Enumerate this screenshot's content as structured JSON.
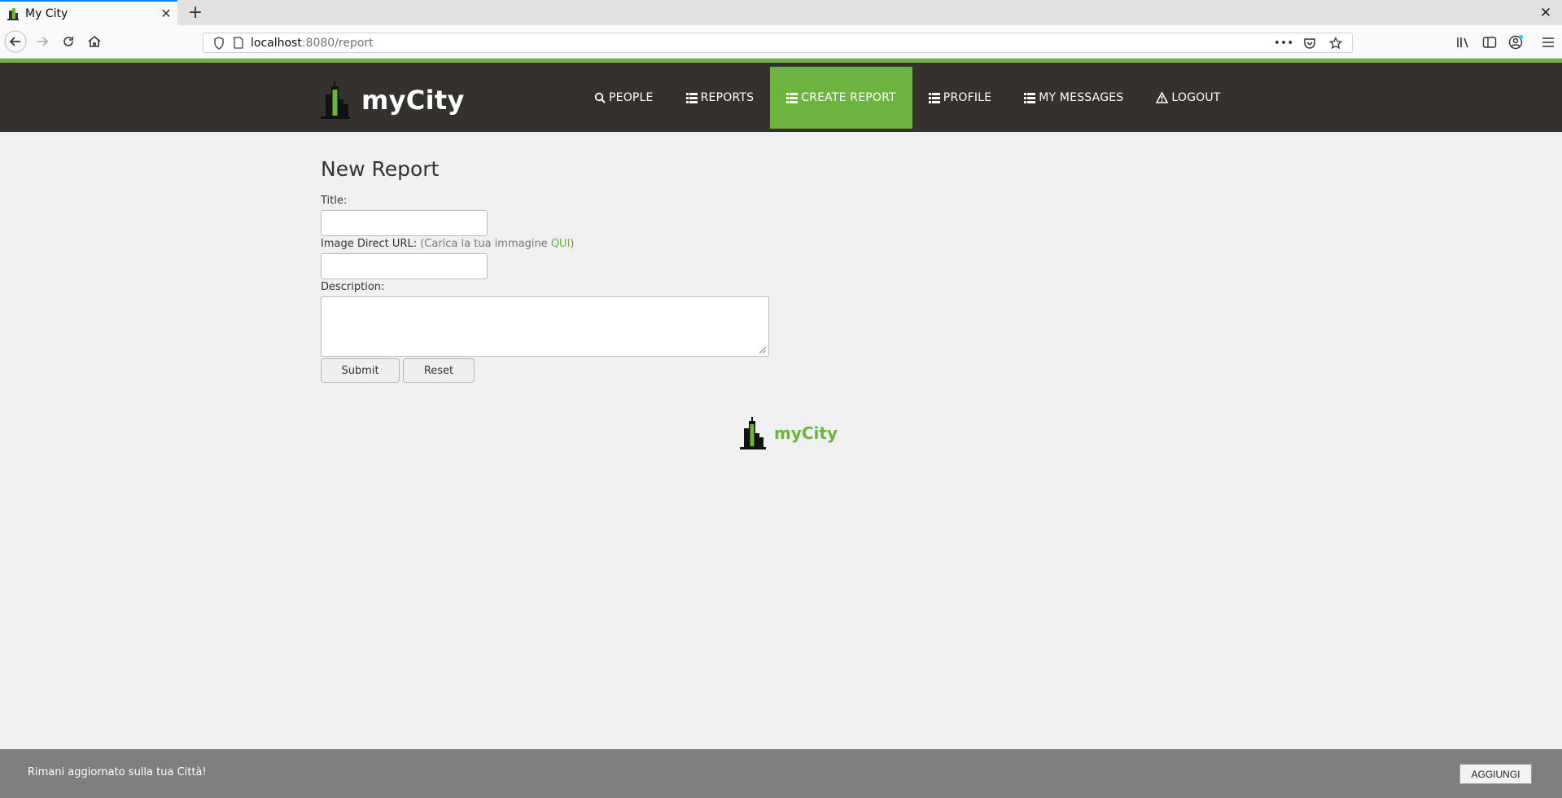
{
  "browser": {
    "tab_title": "My City",
    "url_host": "localhost",
    "url_rest": ":8080/report"
  },
  "site": {
    "brand": "myCity",
    "nav": [
      {
        "label": "PEOPLE",
        "icon": "search-icon"
      },
      {
        "label": "REPORTS",
        "icon": "list-icon"
      },
      {
        "label": "CREATE REPORT",
        "icon": "list-icon",
        "active": true
      },
      {
        "label": "PROFILE",
        "icon": "list-icon"
      },
      {
        "label": "MY MESSAGES",
        "icon": "list-icon"
      },
      {
        "label": "LOGOUT",
        "icon": "warning-icon"
      }
    ],
    "accent_color": "#6cb33f",
    "header_color": "#35312e"
  },
  "form": {
    "heading": "New Report",
    "title_label": "Title:",
    "title_value": "",
    "image_label": "Image Direct URL:",
    "image_hint_open": "(Carica la tua immagine ",
    "image_hint_link": "QUI",
    "image_hint_close": ")",
    "image_value": "",
    "description_label": "Description:",
    "description_value": "",
    "submit_label": "Submit",
    "reset_label": "Reset"
  },
  "footer": {
    "brand": "myCity"
  },
  "cookie_bar": {
    "text": "Rimani aggiornato sulla tua Città!",
    "button_label": "AGGIUNGI"
  }
}
